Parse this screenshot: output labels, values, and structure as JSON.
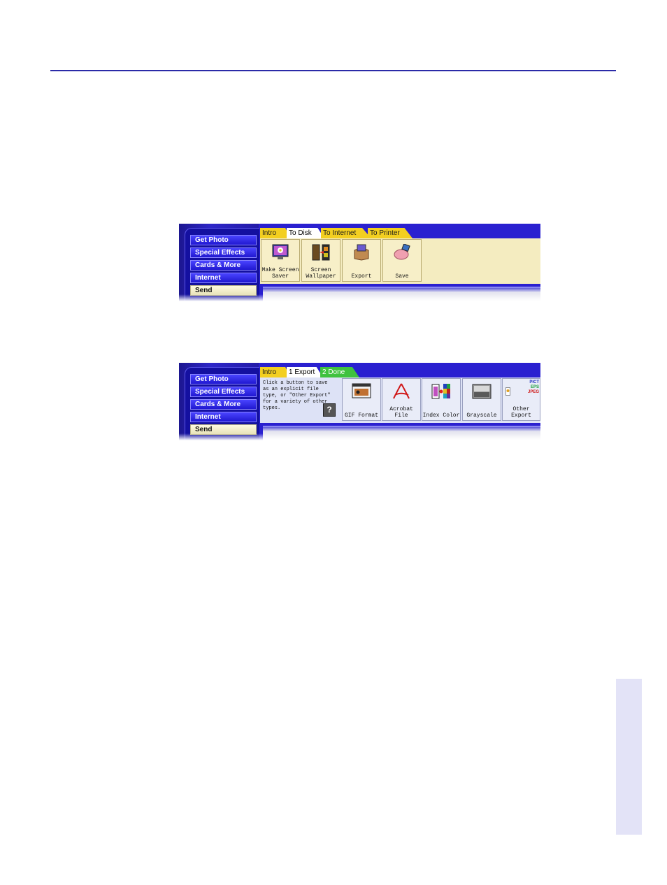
{
  "colors": {
    "rule": "#2b2ba8",
    "side_tab": "#e3e3f7"
  },
  "screenshot1": {
    "nav": [
      "Get Photo",
      "Special Effects",
      "Cards & More",
      "Internet",
      "Send"
    ],
    "active_nav": "Send",
    "tabs": [
      "Intro",
      "To Disk",
      "To Internet",
      "To Printer"
    ],
    "active_tab": "To Disk",
    "tools": [
      {
        "icon": "flower-monitor-icon",
        "label": "Make Screen Saver"
      },
      {
        "icon": "film-wallpaper-icon",
        "label": "Screen Wallpaper"
      },
      {
        "icon": "export-box-icon",
        "label": "Export"
      },
      {
        "icon": "save-pig-icon",
        "label": "Save"
      }
    ]
  },
  "screenshot2": {
    "nav": [
      "Get Photo",
      "Special Effects",
      "Cards & More",
      "Internet",
      "Send"
    ],
    "active_nav": "Send",
    "tabs": [
      "Intro",
      "1 Export",
      "2 Done"
    ],
    "active_tab": "1 Export",
    "hint": "Click a button to save as an explicit file type, or \"Other Export\" for a variety of other types.",
    "help_label": "?",
    "tools": [
      {
        "icon": "gif-film-icon",
        "label": "GIF Format"
      },
      {
        "icon": "acrobat-icon",
        "label": "Acrobat File"
      },
      {
        "icon": "index-color-icon",
        "label": "Index Color"
      },
      {
        "icon": "grayscale-icon",
        "label": "Grayscale"
      },
      {
        "icon": "other-export-icon",
        "label": "Other Export",
        "badge": [
          "PICT",
          "EPS",
          "JPEG"
        ]
      }
    ]
  }
}
